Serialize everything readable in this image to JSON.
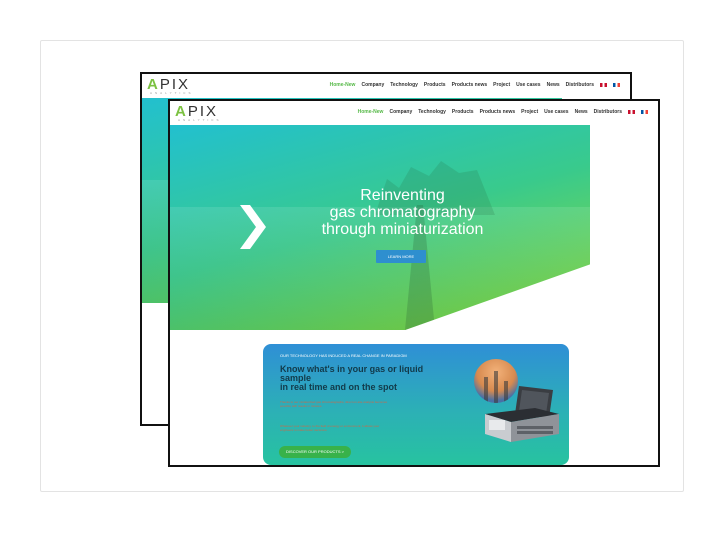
{
  "site": {
    "logo": "APIX",
    "logo_first_letter": "A",
    "logo_rest": "PIX",
    "logo_sub": "ANALYTICS"
  },
  "nav": {
    "items": [
      "Home-New",
      "Company",
      "Technology",
      "Products",
      "Products news",
      "Project",
      "Use cases",
      "News",
      "Distributors"
    ],
    "active": "Home-New",
    "flags": [
      "uk-flag-icon",
      "fr-flag-icon"
    ]
  },
  "hero": {
    "line1": "Reinventing",
    "line2": "gas chromatography",
    "line3": "through miniaturization",
    "cta": "LEARN MORE"
  },
  "promo": {
    "kicker": "OUR TECHNOLOGY HAS INDUCED A REAL CHANGE IN PARADIGM",
    "title_line1": "Know what's in your gas or liquid sample",
    "title_line2": "in real time and on the spot",
    "para1": "Thanks to our miniaturized gas chromatographs, direct on-site analysis becomes possible with results in minutes.",
    "para2": "Whatever your industry, to the field of energy or environment, it allows your engineers to make better decisions.",
    "cta": "DISCOVER OUR PRODUCTS  >"
  },
  "colors": {
    "accent_green": "#56b948",
    "button_blue": "#2e8fcf",
    "frame_border": "#111111"
  }
}
